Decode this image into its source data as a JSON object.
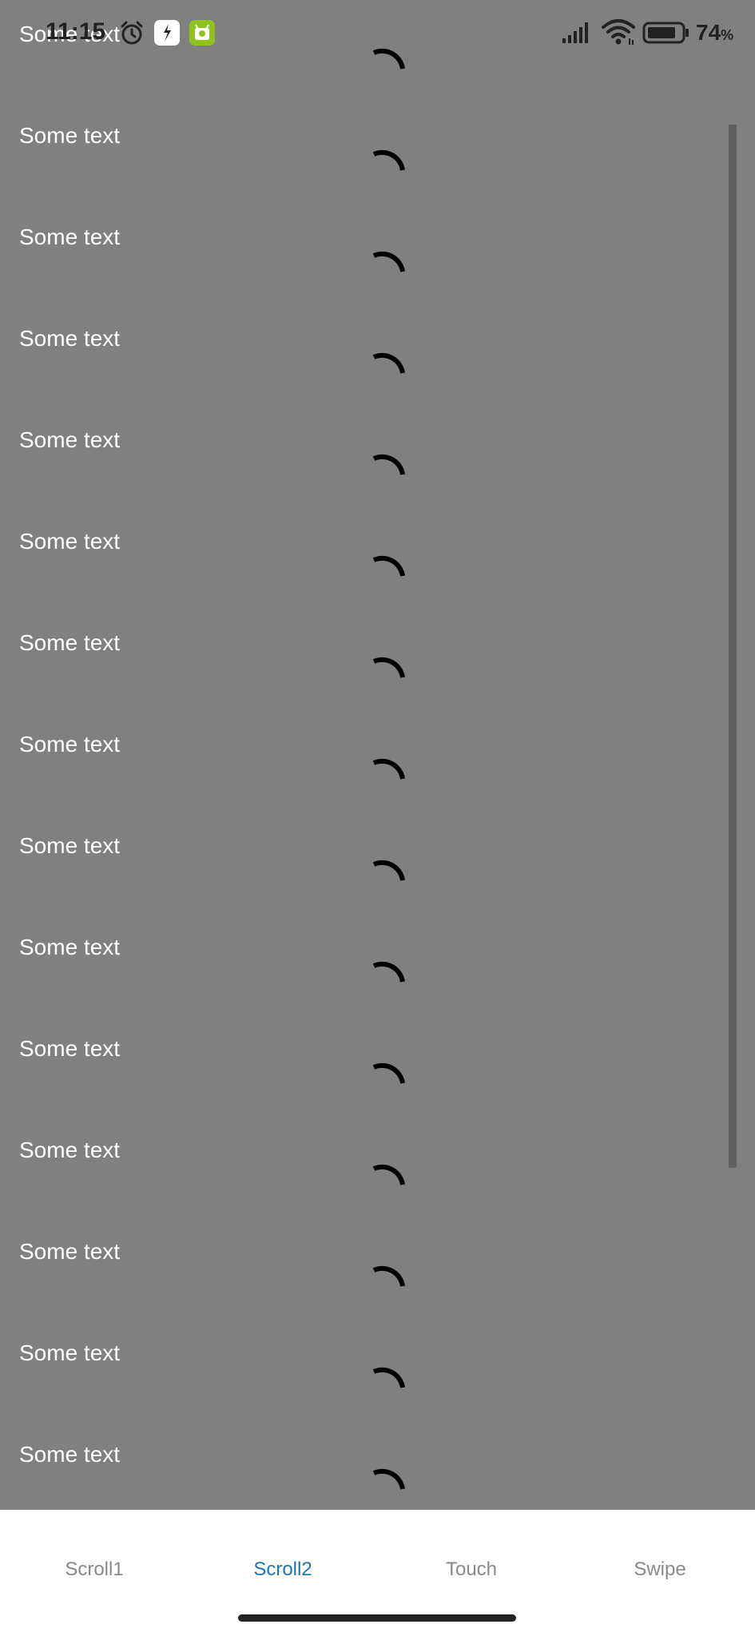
{
  "status_bar": {
    "time": "11:15",
    "battery_percent": "74",
    "battery_unit": "%",
    "icons": [
      "alarm-icon",
      "app-notification-icon",
      "android-camera-icon",
      "signal-icon",
      "wifi-icon",
      "battery-icon"
    ]
  },
  "list": {
    "items": [
      "Some text",
      "Some text",
      "Some text",
      "Some text",
      "Some text",
      "Some text",
      "Some text",
      "Some text",
      "Some text",
      "Some text",
      "Some text",
      "Some text",
      "Some text",
      "Some text",
      "Some text"
    ],
    "spinner_icon": "loading-spinner-icon"
  },
  "bottom_nav": {
    "tabs": [
      {
        "label": "Scroll1",
        "active": false
      },
      {
        "label": "Scroll2",
        "active": true
      },
      {
        "label": "Touch",
        "active": false
      },
      {
        "label": "Swipe",
        "active": false
      }
    ],
    "active_color": "#1f74b0",
    "inactive_color": "#8a8a8a"
  },
  "colors": {
    "background": "#808080",
    "text": "#ffffff",
    "spinner": "#000000"
  }
}
